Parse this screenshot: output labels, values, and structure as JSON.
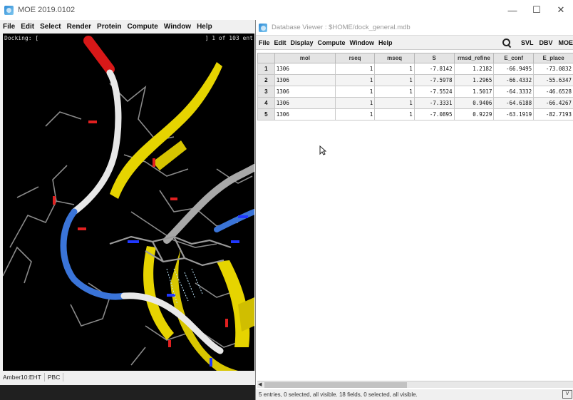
{
  "moe": {
    "title": "MOE 2019.0102",
    "menu": [
      "File",
      "Edit",
      "Select",
      "Render",
      "Protein",
      "Compute",
      "Window",
      "Help"
    ],
    "viewport_status_left": "Docking: [",
    "viewport_status_right": "] 1 of 103 ent",
    "statusbar": [
      "Amber10:EHT",
      "PBC"
    ]
  },
  "window_controls": {
    "minimize": "—",
    "maximize": "☐",
    "close": "✕"
  },
  "dbv": {
    "title": "Database Viewer : $HOME/dock_general.mdb",
    "menu": [
      "File",
      "Edit",
      "Display",
      "Compute",
      "Window",
      "Help"
    ],
    "toolbar_buttons": [
      "SVL",
      "DBV",
      "MOE"
    ],
    "columns": [
      "",
      "mol",
      "rseq",
      "mseq",
      "S",
      "rmsd_refine",
      "E_conf",
      "E_place"
    ],
    "rows": [
      [
        "1",
        "1306",
        "1",
        "1",
        "-7.8142",
        "1.2182",
        "-66.9495",
        "-73.0832"
      ],
      [
        "2",
        "1306",
        "1",
        "1",
        "-7.5978",
        "1.2965",
        "-66.4332",
        "-55.6347"
      ],
      [
        "3",
        "1306",
        "1",
        "1",
        "-7.5524",
        "1.5017",
        "-64.3332",
        "-46.6528"
      ],
      [
        "4",
        "1306",
        "1",
        "1",
        "-7.3331",
        "0.9406",
        "-64.6188",
        "-66.4267"
      ],
      [
        "5",
        "1306",
        "1",
        "1",
        "-7.0895",
        "0.9229",
        "-63.1919",
        "-82.7193"
      ]
    ],
    "status": "5 entries, 0 selected, all visible. 18 fields, 0 selected, all visible.",
    "corner_label": "V"
  },
  "colors": {
    "ribbon_yellow": "#e6d400",
    "ribbon_blue": "#3a74d8",
    "ribbon_white": "#e8e8e8",
    "ribbon_red": "#d81818",
    "atom_blue": "#2038ff",
    "atom_red": "#e02020"
  }
}
